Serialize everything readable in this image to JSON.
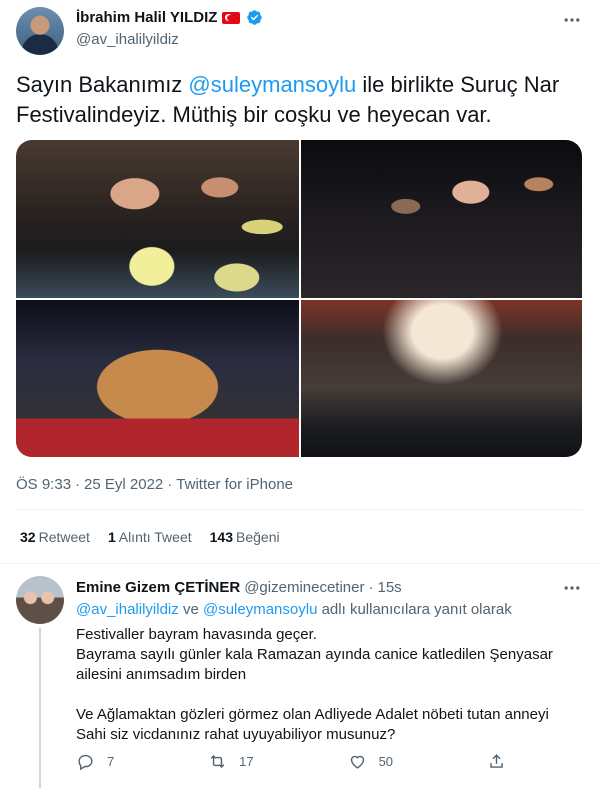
{
  "tweet": {
    "author_name": "İbrahim Halil YILDIZ",
    "handle": "@av_ihalilyildiz",
    "text_before": "Sayın Bakanımız ",
    "mention": "@suleymansoylu",
    "text_after": " ile birlikte Suruç Nar Festivalindeyiz. Müthiş bir coşku ve heyecan var.",
    "time": "ÖS 9:33",
    "date": "25 Eyl 2022",
    "source": "Twitter for iPhone",
    "separator": "·",
    "stats": [
      {
        "count": "32",
        "label": "Retweet"
      },
      {
        "count": "1",
        "label": "Alıntı Tweet"
      },
      {
        "count": "143",
        "label": "Beğeni"
      }
    ]
  },
  "reply": {
    "author_name": "Emine Gizem ÇETİNER",
    "handle": "@gizeminecetiner",
    "separator": "·",
    "time": "15s",
    "reply_to_user1": "@av_ihalilyildiz",
    "reply_to_and": " ve ",
    "reply_to_user2": "@suleymansoylu",
    "reply_to_suffix": " adlı kullanıcılara yanıt olarak",
    "lines": [
      "Festivaller bayram havasında geçer.",
      "Bayrama sayılı günler kala Ramazan ayında canice katledilen Şenyasar ailesini anımsadım birden",
      "Ve Ağlamaktan gözleri görmez olan Adliyede Adalet nöbeti tutan anneyi Sahi siz vicdanınız rahat uyuyabiliyor musunuz?"
    ],
    "reply_count": "7",
    "retweet_count": "17",
    "like_count": "50"
  },
  "colors": {
    "accent": "#1d9bf0",
    "text": "#0f1419",
    "secondary": "#536471",
    "flag": "#e30a17"
  },
  "icons": [
    "verified-badge-icon",
    "more-icon",
    "turkey-flag-icon",
    "reply-icon",
    "retweet-icon",
    "like-icon",
    "share-icon"
  ]
}
